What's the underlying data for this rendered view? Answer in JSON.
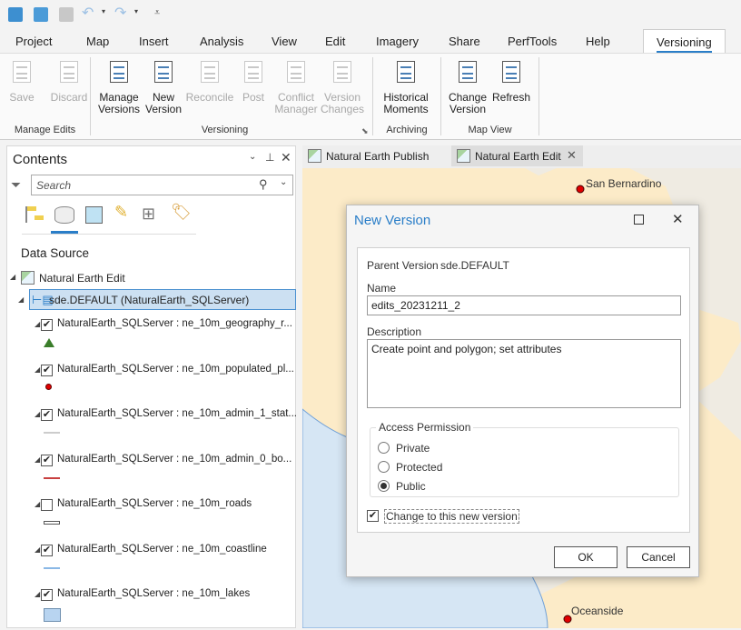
{
  "quick_access": {
    "icons": [
      "new-project-icon",
      "open-project-icon",
      "print-icon",
      "undo-icon",
      "redo-icon",
      "customize-icon"
    ]
  },
  "menu_tabs": [
    "Project",
    "Map",
    "Insert",
    "Analysis",
    "View",
    "Edit",
    "Imagery",
    "Share",
    "PerfTools",
    "Help",
    "Versioning"
  ],
  "active_tab": "Versioning",
  "ribbon": {
    "buttons": [
      {
        "line1": "Save",
        "line2": "",
        "enabled": false
      },
      {
        "line1": "Discard",
        "line2": "",
        "enabled": false
      },
      {
        "line1": "Manage",
        "line2": "Versions",
        "enabled": true
      },
      {
        "line1": "New",
        "line2": "Version",
        "enabled": true
      },
      {
        "line1": "Reconcile",
        "line2": "",
        "enabled": false
      },
      {
        "line1": "Post",
        "line2": "",
        "enabled": false
      },
      {
        "line1": "Conflict",
        "line2": "Manager",
        "enabled": false
      },
      {
        "line1": "Version",
        "line2": "Changes",
        "enabled": false
      },
      {
        "line1": "Historical",
        "line2": "Moments",
        "enabled": true
      },
      {
        "line1": "Change",
        "line2": "Version",
        "enabled": true
      },
      {
        "line1": "Refresh",
        "line2": "",
        "enabled": true
      }
    ],
    "groups": [
      "Manage Edits",
      "Versioning",
      "Archiving",
      "Map View"
    ]
  },
  "contents": {
    "title": "Contents",
    "search_placeholder": "Search",
    "section": "Data Source",
    "map_name": "Natural Earth Edit",
    "connection": "sde.DEFAULT (NaturalEarth_SQLServer)",
    "layers": [
      {
        "name": "NaturalEarth_SQLServer : ne_10m_geography_r...",
        "checked": true,
        "symbol": "triangle",
        "color": "#3a7d2a"
      },
      {
        "name": "NaturalEarth_SQLServer : ne_10m_populated_pl...",
        "checked": true,
        "symbol": "dot",
        "color": "#e00000"
      },
      {
        "name": "NaturalEarth_SQLServer : ne_10m_admin_1_stat...",
        "checked": true,
        "symbol": "line",
        "color": "#cccccc"
      },
      {
        "name": "NaturalEarth_SQLServer : ne_10m_admin_0_bo...",
        "checked": true,
        "symbol": "line",
        "color": "#c84040"
      },
      {
        "name": "NaturalEarth_SQLServer : ne_10m_roads",
        "checked": false,
        "symbol": "road",
        "color": "#555555"
      },
      {
        "name": "NaturalEarth_SQLServer : ne_10m_coastline",
        "checked": true,
        "symbol": "line",
        "color": "#8ab8e6"
      },
      {
        "name": "NaturalEarth_SQLServer : ne_10m_lakes",
        "checked": true,
        "symbol": "fill",
        "color": "#b8d4f0"
      }
    ]
  },
  "map": {
    "tabs": [
      {
        "label": "Natural Earth Publish",
        "active": false
      },
      {
        "label": "Natural Earth Edit",
        "active": true
      }
    ],
    "labels": [
      "San Bernardino",
      "Oceanside"
    ],
    "colors": {
      "land": "#fcebc8",
      "water": "#d6e6f4",
      "other": "#efebe2"
    }
  },
  "dialog": {
    "title": "New Version",
    "parent_label": "Parent Version",
    "parent_value": "sde.DEFAULT",
    "name_label": "Name",
    "name_value": "edits_20231211_2",
    "description_label": "Description",
    "description_value": "Create point and polygon; set attributes",
    "access_label": "Access Permission",
    "access_options": [
      "Private",
      "Protected",
      "Public"
    ],
    "access_selected": "Public",
    "change_label": "Change to this new version",
    "change_checked": true,
    "ok": "OK",
    "cancel": "Cancel",
    "title_color": "#2a7ec8"
  }
}
